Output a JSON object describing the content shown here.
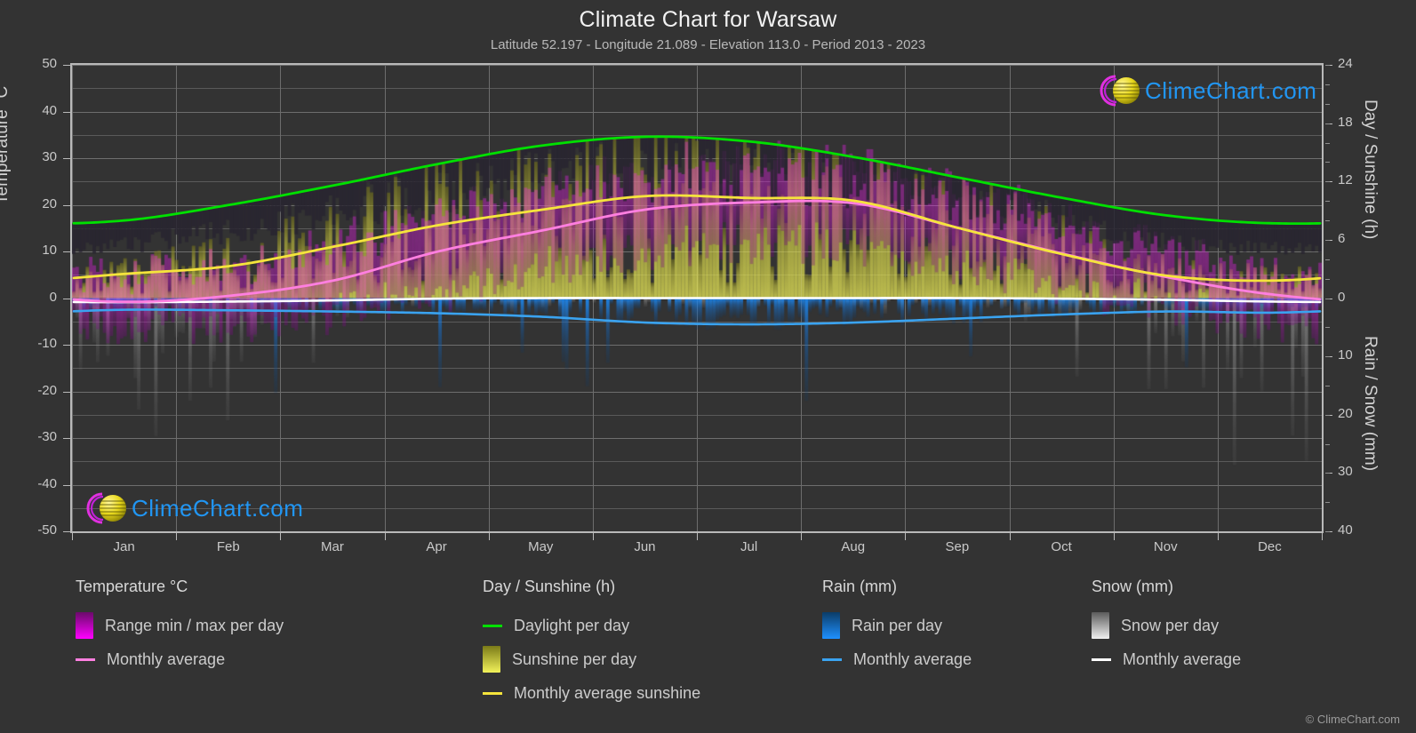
{
  "header": {
    "title": "Climate Chart for Warsaw",
    "subtitle": "Latitude 52.197 - Longitude 21.089 - Elevation 113.0 - Period 2013 - 2023"
  },
  "branding": {
    "logo_text": "ClimeChart.com",
    "copyright": "© ClimeChart.com",
    "logo_arc_color": "#e030e0",
    "logo_sphere_color": "#e8e020",
    "logo_text_color": "#2196f3"
  },
  "axes": {
    "left_title": "Temperature °C",
    "left_ticks": [
      "50",
      "40",
      "30",
      "20",
      "10",
      "0",
      "-10",
      "-20",
      "-30",
      "-40",
      "-50"
    ],
    "right_top_title": "Day / Sunshine (h)",
    "right_top_ticks": [
      "24",
      "18",
      "12",
      "6",
      "0"
    ],
    "right_bottom_title": "Rain / Snow (mm)",
    "right_bottom_ticks": [
      "10",
      "20",
      "30",
      "40"
    ],
    "x_ticks": [
      "Jan",
      "Feb",
      "Mar",
      "Apr",
      "May",
      "Jun",
      "Jul",
      "Aug",
      "Sep",
      "Oct",
      "Nov",
      "Dec"
    ]
  },
  "legend": {
    "columns": [
      {
        "heading": "Temperature °C",
        "items": [
          {
            "label": "Range min / max per day",
            "marker": "swatch",
            "color": "#ff00ff",
            "color2": "#6a0a6a"
          },
          {
            "label": "Monthly average",
            "marker": "line",
            "color": "#ff7fe0"
          }
        ]
      },
      {
        "heading": "Day / Sunshine (h)",
        "items": [
          {
            "label": "Daylight per day",
            "marker": "line",
            "color": "#00e000"
          },
          {
            "label": "Sunshine per day",
            "marker": "swatch",
            "color": "#f2f25a",
            "color2": "#7a7a18"
          },
          {
            "label": "Monthly average sunshine",
            "marker": "line",
            "color": "#f5e43c"
          }
        ]
      },
      {
        "heading": "Rain (mm)",
        "items": [
          {
            "label": "Rain per day",
            "marker": "swatch",
            "color": "#1e90ff",
            "color2": "#0b3c66"
          },
          {
            "label": "Monthly average",
            "marker": "line",
            "color": "#3aa3f0"
          }
        ]
      },
      {
        "heading": "Snow (mm)",
        "items": [
          {
            "label": "Snow per day",
            "marker": "swatch",
            "color": "#f0f0f0",
            "color2": "#5a5a5a"
          },
          {
            "label": "Monthly average",
            "marker": "line",
            "color": "#ffffff"
          }
        ]
      }
    ]
  },
  "chart_data": {
    "type": "line",
    "title": "Climate Chart for Warsaw",
    "subtitle": "Latitude 52.197 - Longitude 21.089 - Elevation 113.0 - Period 2013 - 2023",
    "xlabel": "",
    "ylabel": "Temperature °C",
    "ylim": [
      -50,
      50
    ],
    "y2_top_label": "Day / Sunshine (h)",
    "y2_top_lim": [
      0,
      24
    ],
    "y2_bottom_label": "Rain / Snow (mm)",
    "y2_bottom_lim": [
      0,
      40
    ],
    "grid": true,
    "legend_position": "below",
    "categories": [
      "Jan",
      "Feb",
      "Mar",
      "Apr",
      "May",
      "Jun",
      "Jul",
      "Aug",
      "Sep",
      "Oct",
      "Nov",
      "Dec"
    ],
    "series": [
      {
        "name": "Daylight per day",
        "unit": "h",
        "color": "#00e000",
        "axis": "right-top",
        "values": [
          8.0,
          9.6,
          11.6,
          13.8,
          15.7,
          16.6,
          16.1,
          14.5,
          12.4,
          10.3,
          8.5,
          7.7
        ]
      },
      {
        "name": "Monthly average sunshine",
        "unit": "h",
        "color": "#f5e43c",
        "axis": "right-top",
        "values": [
          2.5,
          3.3,
          5.3,
          7.5,
          9.1,
          10.5,
          10.3,
          10.0,
          7.2,
          4.5,
          2.3,
          1.8
        ]
      },
      {
        "name": "Temperature monthly average",
        "unit": "°C",
        "color": "#ff7fe0",
        "axis": "left",
        "values": [
          -0.8,
          0.5,
          3.8,
          10.0,
          14.5,
          19.0,
          20.5,
          20.3,
          15.0,
          9.5,
          4.5,
          0.8
        ]
      },
      {
        "name": "Rain monthly average",
        "unit": "mm",
        "color": "#3aa3f0",
        "axis": "right-bottom",
        "values": [
          2.0,
          2.1,
          2.3,
          2.6,
          3.2,
          4.2,
          4.5,
          4.2,
          3.5,
          2.8,
          2.3,
          2.5
        ]
      },
      {
        "name": "Snow monthly average",
        "unit": "mm",
        "color": "#ffffff",
        "axis": "right-bottom",
        "values": [
          0.7,
          0.6,
          0.4,
          0.1,
          0.0,
          0.0,
          0.0,
          0.0,
          0.0,
          0.1,
          0.3,
          0.6
        ]
      },
      {
        "name": "Temperature range min per day",
        "unit": "°C",
        "color": "#ff00ff",
        "axis": "left",
        "values": [
          -4.0,
          -3.5,
          -1.0,
          3.5,
          8.0,
          12.0,
          13.5,
          13.0,
          9.0,
          4.5,
          0.5,
          -3.0
        ]
      },
      {
        "name": "Temperature range max per day",
        "unit": "°C",
        "color": "#ff00ff",
        "axis": "left",
        "values": [
          3.0,
          4.5,
          9.0,
          16.5,
          21.0,
          25.5,
          27.0,
          26.5,
          21.0,
          14.5,
          8.0,
          4.0
        ]
      }
    ]
  }
}
